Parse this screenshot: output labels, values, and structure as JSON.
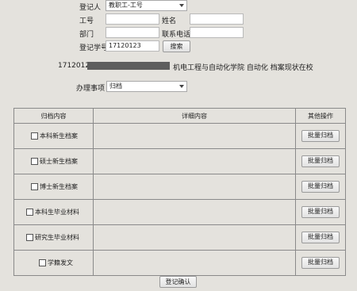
{
  "form": {
    "registrant_type_label": "登记人",
    "registrant_type_value": "教职工-工号",
    "staff_id_label": "工号",
    "staff_id_value": "",
    "name_label": "姓名",
    "name_value": "",
    "department_label": "部门",
    "department_value": "",
    "phone_label": "联系电话",
    "phone_value": "",
    "student_id_label": "登记学号",
    "student_id_value": "17120123",
    "search_label": "搜索"
  },
  "student_info": {
    "id": "17120123",
    "details": "机电工程与自动化学院 自动化 档案现状在校"
  },
  "business": {
    "label": "办理事项",
    "value": "归档"
  },
  "table": {
    "headers": [
      "归档内容",
      "详细内容",
      "其他操作"
    ],
    "rows": [
      {
        "label": "本科新生档案",
        "action": "批量归档"
      },
      {
        "label": "硕士新生档案",
        "action": "批量归档"
      },
      {
        "label": "博士新生档案",
        "action": "批量归档"
      },
      {
        "label": "本科生毕业材料",
        "action": "批量归档"
      },
      {
        "label": "研究生毕业材料",
        "action": "批量归档"
      },
      {
        "label": "学籍发文",
        "action": "批量归档"
      }
    ]
  },
  "confirm_label": "登记确认"
}
